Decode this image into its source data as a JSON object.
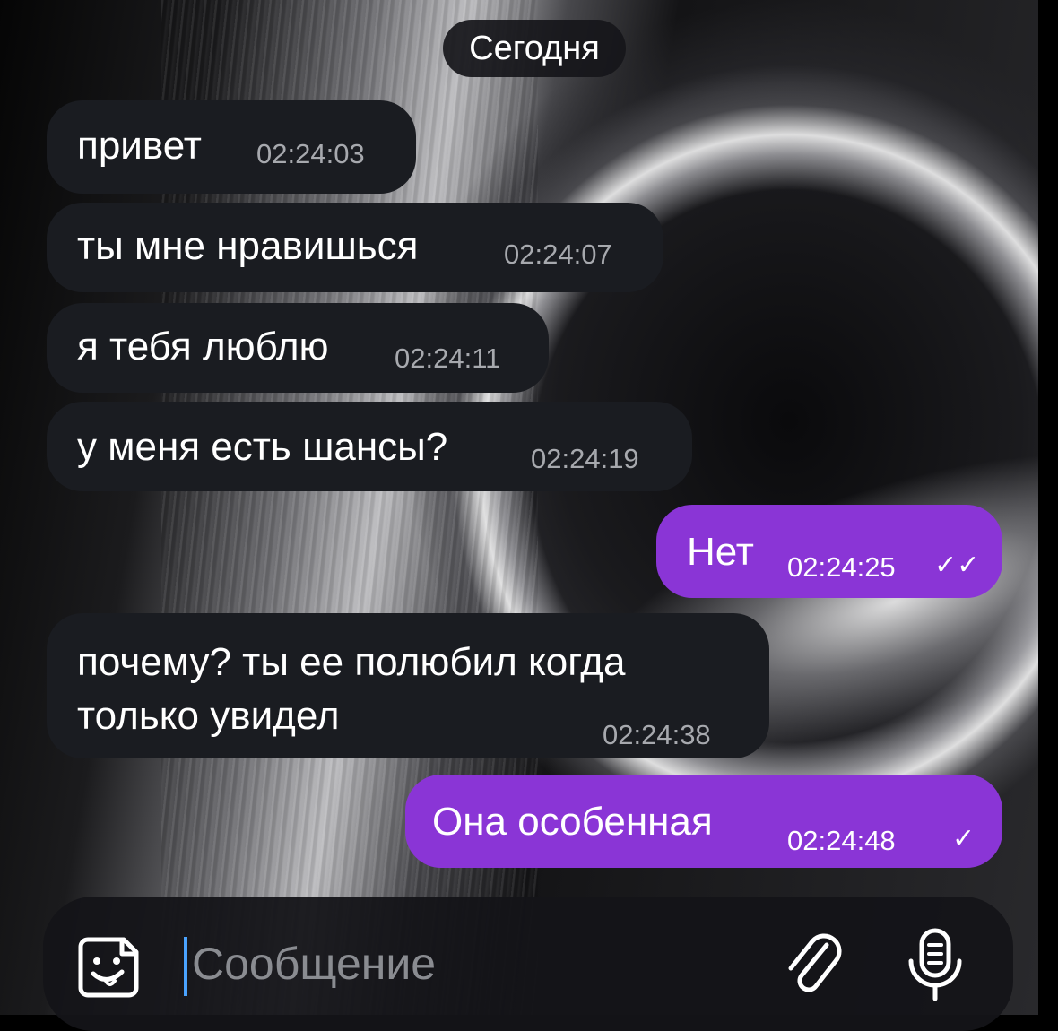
{
  "chat": {
    "date_separator": "Сегодня",
    "messages": [
      {
        "direction": "incoming",
        "text": "привет",
        "time": "02:24:03"
      },
      {
        "direction": "incoming",
        "text": "ты мне нравишься",
        "time": "02:24:07"
      },
      {
        "direction": "incoming",
        "text": "я тебя люблю",
        "time": "02:24:11"
      },
      {
        "direction": "incoming",
        "text": "у меня есть шансы?",
        "time": "02:24:19"
      },
      {
        "direction": "outgoing",
        "text": "Нет",
        "time": "02:24:25",
        "status": "read"
      },
      {
        "direction": "incoming",
        "text_line1": "почему? ты ее полюбил когда",
        "text_line2": "только увидел",
        "time": "02:24:38"
      },
      {
        "direction": "outgoing",
        "text": "Она особенная",
        "time": "02:24:48",
        "status": "sent"
      }
    ]
  },
  "composer": {
    "placeholder": "Сообщение",
    "emoji_icon": "sticker-face-icon",
    "attach_icon": "paperclip-icon",
    "mic_icon": "microphone-icon"
  },
  "colors": {
    "incoming_bubble": "#1a1c21",
    "outgoing_bubble": "#8a35d6",
    "cursor": "#4aa3ff"
  }
}
